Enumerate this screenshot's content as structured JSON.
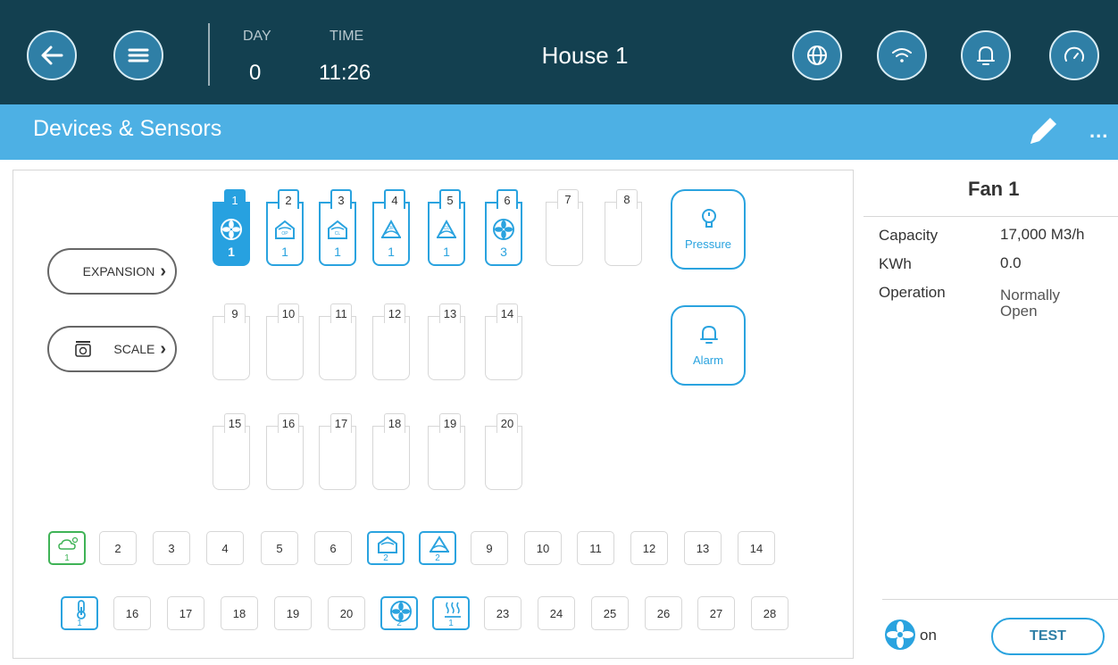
{
  "header": {
    "day_label": "DAY",
    "day_value": "0",
    "time_label": "TIME",
    "time_value": "11:26",
    "house": "House 1"
  },
  "toolbar": {
    "title": "Devices & Sensors",
    "more_label": "..."
  },
  "expansion": {
    "label": "EXPANSION"
  },
  "scale": {
    "label": "SCALE"
  },
  "relay_slots": [
    {
      "num": "1",
      "icon": "fan-icon",
      "count": "1",
      "state": "selected"
    },
    {
      "num": "2",
      "icon": "inlet-op-icon",
      "count": "1",
      "state": "active"
    },
    {
      "num": "3",
      "icon": "inlet-cl-icon",
      "count": "1",
      "state": "active"
    },
    {
      "num": "4",
      "icon": "curtain-op-icon",
      "count": "1",
      "state": "active"
    },
    {
      "num": "5",
      "icon": "curtain-cl-icon",
      "count": "1",
      "state": "active"
    },
    {
      "num": "6",
      "icon": "fan-icon",
      "count": "3",
      "state": "active"
    },
    {
      "num": "7",
      "icon": "",
      "count": "",
      "state": "empty"
    },
    {
      "num": "8",
      "icon": "",
      "count": "",
      "state": "empty"
    },
    {
      "num": "9",
      "icon": "",
      "count": "",
      "state": "empty"
    },
    {
      "num": "10",
      "icon": "",
      "count": "",
      "state": "empty"
    },
    {
      "num": "11",
      "icon": "",
      "count": "",
      "state": "empty"
    },
    {
      "num": "12",
      "icon": "",
      "count": "",
      "state": "empty"
    },
    {
      "num": "13",
      "icon": "",
      "count": "",
      "state": "empty"
    },
    {
      "num": "14",
      "icon": "",
      "count": "",
      "state": "empty"
    },
    {
      "num": "15",
      "icon": "",
      "count": "",
      "state": "empty"
    },
    {
      "num": "16",
      "icon": "",
      "count": "",
      "state": "empty"
    },
    {
      "num": "17",
      "icon": "",
      "count": "",
      "state": "empty"
    },
    {
      "num": "18",
      "icon": "",
      "count": "",
      "state": "empty"
    },
    {
      "num": "19",
      "icon": "",
      "count": "",
      "state": "empty"
    },
    {
      "num": "20",
      "icon": "",
      "count": "",
      "state": "empty"
    }
  ],
  "pressure": {
    "label": "Pressure"
  },
  "alarm": {
    "label": "Alarm"
  },
  "analog_row1": [
    {
      "label": "",
      "icon": "weather-icon",
      "count": "1",
      "state": "green"
    },
    {
      "label": "2",
      "state": "empty"
    },
    {
      "label": "3",
      "state": "empty"
    },
    {
      "label": "4",
      "state": "empty"
    },
    {
      "label": "5",
      "state": "empty"
    },
    {
      "label": "6",
      "state": "empty"
    },
    {
      "label": "",
      "icon": "inlet-icon",
      "count": "2",
      "state": "active"
    },
    {
      "label": "",
      "icon": "curtain-icon",
      "count": "2",
      "state": "active"
    },
    {
      "label": "9",
      "state": "empty"
    },
    {
      "label": "10",
      "state": "empty"
    },
    {
      "label": "11",
      "state": "empty"
    },
    {
      "label": "12",
      "state": "empty"
    },
    {
      "label": "13",
      "state": "empty"
    },
    {
      "label": "14",
      "state": "empty"
    }
  ],
  "analog_row2": [
    {
      "label": "",
      "icon": "thermometer-icon",
      "count": "1",
      "state": "active"
    },
    {
      "label": "16",
      "state": "empty"
    },
    {
      "label": "17",
      "state": "empty"
    },
    {
      "label": "18",
      "state": "empty"
    },
    {
      "label": "19",
      "state": "empty"
    },
    {
      "label": "20",
      "state": "empty"
    },
    {
      "label": "",
      "icon": "fan-icon",
      "count": "2",
      "state": "active"
    },
    {
      "label": "",
      "icon": "heater-icon",
      "count": "1",
      "state": "active"
    },
    {
      "label": "23",
      "state": "empty"
    },
    {
      "label": "24",
      "state": "empty"
    },
    {
      "label": "25",
      "state": "empty"
    },
    {
      "label": "26",
      "state": "empty"
    },
    {
      "label": "27",
      "state": "empty"
    },
    {
      "label": "28",
      "state": "empty"
    }
  ],
  "info": {
    "title": "Fan 1",
    "capacity_label": "Capacity",
    "capacity_value": "17,000 M3/h",
    "kwh_label": "KWh",
    "kwh_value": "0.0",
    "operation_label": "Operation",
    "operation_value_1": "Normally",
    "operation_value_2": "Open",
    "status": "on",
    "test_label": "TEST"
  },
  "colors": {
    "header_bg": "#134050",
    "toolbar_bg": "#4db0e4",
    "accent": "#2aa3df",
    "green": "#3fb356"
  }
}
